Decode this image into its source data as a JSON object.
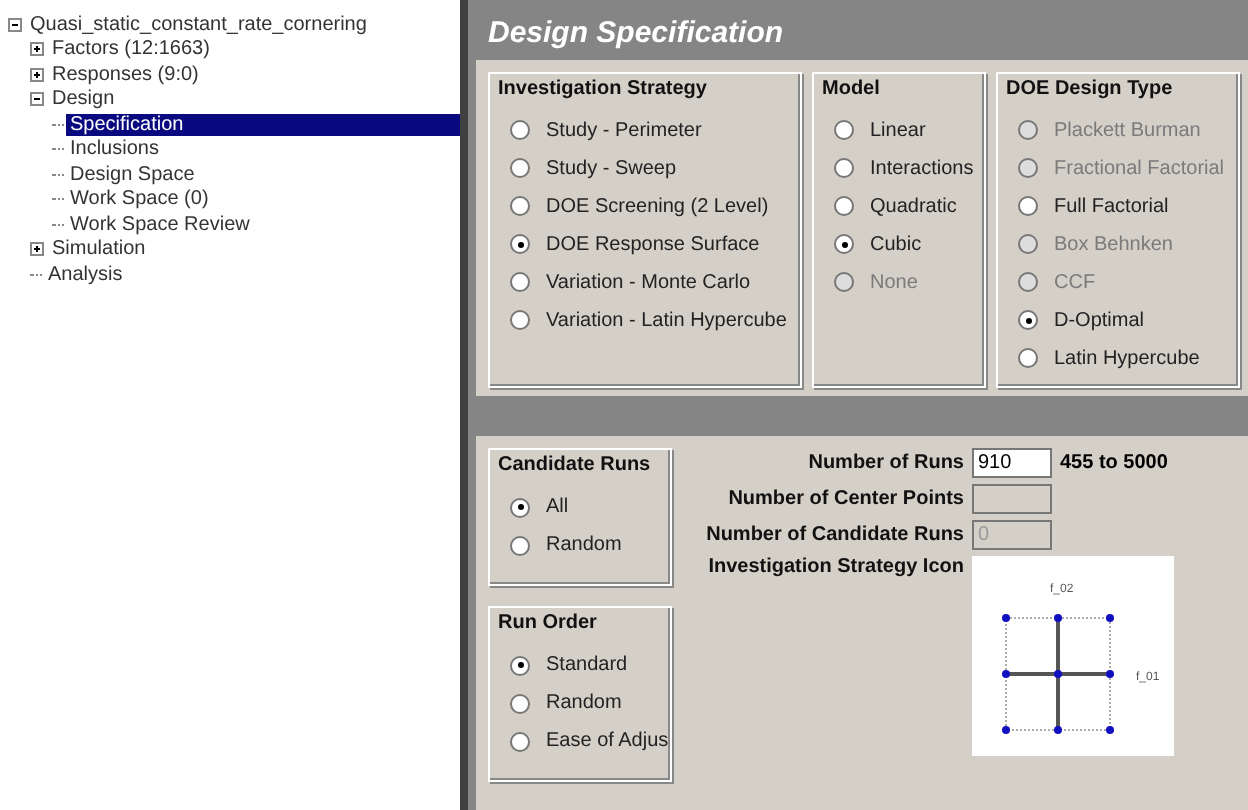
{
  "tree": [
    {
      "label": "Quasi_static_constant_rate_cornering",
      "expanded": true,
      "selected": false,
      "children": [
        {
          "label": "Factors (12:1663)",
          "expanded": false,
          "selected": false
        },
        {
          "label": "Responses (9:0)",
          "expanded": false,
          "selected": false
        },
        {
          "label": "Design",
          "expanded": true,
          "selected": false,
          "children": [
            {
              "label": "Specification",
              "selected": true
            },
            {
              "label": "Inclusions",
              "selected": false
            },
            {
              "label": "Design Space",
              "selected": false
            },
            {
              "label": "Work Space (0)",
              "selected": false
            },
            {
              "label": "Work Space Review",
              "selected": false
            }
          ]
        },
        {
          "label": "Simulation",
          "expanded": false,
          "selected": false
        },
        {
          "label": "Analysis",
          "selected": false
        }
      ]
    }
  ],
  "header": {
    "title": "Design Specification"
  },
  "top_groups": [
    {
      "title": "Investigation Strategy",
      "options": [
        {
          "label": "Study - Perimeter",
          "selected": false,
          "disabled": false
        },
        {
          "label": "Study - Sweep",
          "selected": false,
          "disabled": false
        },
        {
          "label": "DOE Screening (2 Level)",
          "selected": false,
          "disabled": false
        },
        {
          "label": "DOE Response Surface",
          "selected": true,
          "disabled": false
        },
        {
          "label": "Variation - Monte Carlo",
          "selected": false,
          "disabled": false
        },
        {
          "label": "Variation - Latin Hypercube",
          "selected": false,
          "disabled": false
        }
      ]
    },
    {
      "title": "Model",
      "options": [
        {
          "label": "Linear",
          "selected": false,
          "disabled": false
        },
        {
          "label": "Interactions",
          "selected": false,
          "disabled": false
        },
        {
          "label": "Quadratic",
          "selected": false,
          "disabled": false
        },
        {
          "label": "Cubic",
          "selected": true,
          "disabled": false
        },
        {
          "label": "None",
          "selected": false,
          "disabled": true
        }
      ]
    },
    {
      "title": "DOE Design Type",
      "options": [
        {
          "label": "Plackett Burman",
          "selected": false,
          "disabled": true
        },
        {
          "label": "Fractional Factorial",
          "selected": false,
          "disabled": true
        },
        {
          "label": "Full Factorial",
          "selected": false,
          "disabled": false
        },
        {
          "label": "Box Behnken",
          "selected": false,
          "disabled": true
        },
        {
          "label": "CCF",
          "selected": false,
          "disabled": true
        },
        {
          "label": "D-Optimal",
          "selected": true,
          "disabled": false
        },
        {
          "label": "Latin Hypercube",
          "selected": false,
          "disabled": false
        }
      ]
    }
  ],
  "bottom_groups": [
    {
      "title": "Candidate Runs",
      "options": [
        {
          "label": "All",
          "selected": true,
          "disabled": false
        },
        {
          "label": "Random",
          "selected": false,
          "disabled": false
        }
      ]
    },
    {
      "title": "Run Order",
      "options": [
        {
          "label": "Standard",
          "selected": true,
          "disabled": false
        },
        {
          "label": "Random",
          "selected": false,
          "disabled": false
        },
        {
          "label": "Ease of Adjus",
          "selected": false,
          "disabled": false
        }
      ]
    }
  ],
  "fields": [
    {
      "label": "Number of Runs",
      "value": "910",
      "disabled": false,
      "range": "455 to 5000"
    },
    {
      "label": "Number of Center Points",
      "disabled": true
    },
    {
      "label": "Number of Candidate Runs",
      "value": "0",
      "disabled": true
    }
  ],
  "strategy_icon": {
    "label": "Investigation Strategy Icon",
    "y_axis": "f_02",
    "x_axis": "f_01"
  }
}
